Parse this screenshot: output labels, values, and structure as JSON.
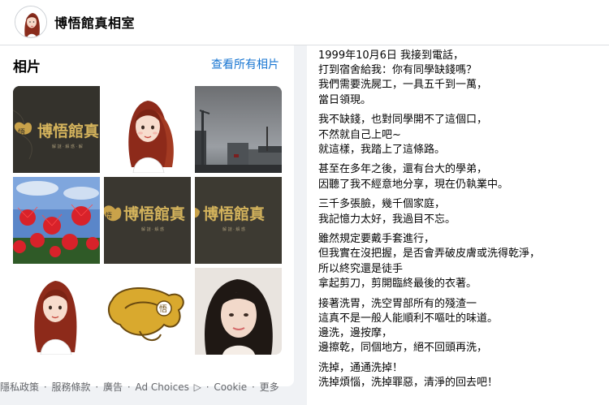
{
  "page": {
    "name": "博悟館真相室"
  },
  "photos": {
    "title": "相片",
    "see_all": "查看所有相片",
    "tiles": [
      {
        "kind": "logo-dark"
      },
      {
        "kind": "portrait-illustration"
      },
      {
        "kind": "cloudy-sky-street"
      },
      {
        "kind": "red-spider-lilies"
      },
      {
        "kind": "logo-dark"
      },
      {
        "kind": "logo-dark"
      },
      {
        "kind": "portrait-illustration"
      },
      {
        "kind": "logo-gold"
      },
      {
        "kind": "woman-selfie"
      }
    ],
    "logo_text": "博悟館真",
    "logo_badge": "悟"
  },
  "footer": {
    "items": [
      "隱私政策",
      "服務條款",
      "廣告",
      "Ad Choices",
      "Cookie",
      "更多"
    ],
    "separator": "·"
  },
  "post": {
    "paragraphs": [
      [
        "1999年10月6日 我接到電話，",
        "打到宿舍給我：你有同學缺錢嗎？",
        "我們需要洗屍工，一具五千到一萬，",
        "當日領現。"
      ],
      [
        "我不缺錢，也對同學開不了這個口，",
        "不然就自己上吧~",
        "就這樣，我踏上了這條路。"
      ],
      [
        "甚至在多年之後，還有台大的學弟，",
        "因聽了我不經意地分享，現在仍執業中。"
      ],
      [
        "三千多張臉，幾千個家庭，",
        "我記憶力太好，我過目不忘。"
      ],
      [
        "雖然規定要戴手套進行，",
        "但我實在沒把握，是否會弄破皮膚或洗得乾淨，",
        "所以終究還是徒手",
        "拿起剪刀，剪開臨終最後的衣著。"
      ],
      [
        "接著洗胃，洗空胃部所有的殘渣一",
        "這真不是一般人能順利不嘔吐的味道。",
        "邊洗，邊按摩，",
        "邊擦乾，同個地方，絕不回頭再洗，"
      ],
      [
        "洗掉，通通洗掉！",
        "洗掉煩惱，洗掉罪惡，清淨的回去吧！"
      ]
    ]
  },
  "colors": {
    "link": "#1876d2",
    "muted": "#65676b",
    "background": "#f0f2f5"
  }
}
